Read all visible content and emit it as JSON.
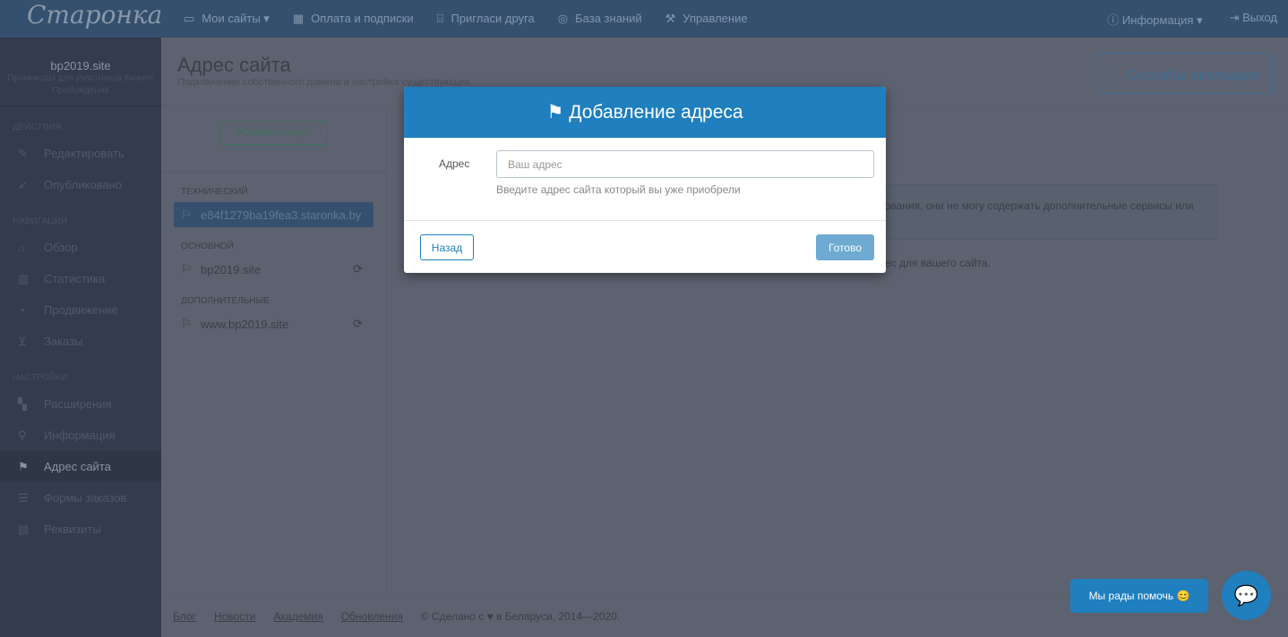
{
  "header": {
    "logo": "Старонка",
    "nav": [
      {
        "icon": "inbox-icon",
        "label": "Мои сайты ▾"
      },
      {
        "icon": "calendar-icon",
        "label": "Оплата и подписки"
      },
      {
        "icon": "gift-icon",
        "label": "Пригласи друга"
      },
      {
        "icon": "lifebuoy-icon",
        "label": "База знаний"
      },
      {
        "icon": "wrench-icon",
        "label": "Управление"
      }
    ],
    "info": "Информация ▾",
    "logout": "Выход"
  },
  "sidebar": {
    "site_name": "bp2019.site",
    "site_desc": "Промокоды для участников Бизнес Пробуждения",
    "sections": [
      {
        "title": "Действия",
        "items": [
          "Редактировать",
          "Опубликовано"
        ]
      },
      {
        "title": "Навигация",
        "items": [
          "Обзор",
          "Статистика",
          "Продвижение",
          "Заказы"
        ]
      },
      {
        "title": "Настройки",
        "items": [
          "Расширения",
          "Информация",
          "Адрес сайта",
          "Формы заказов",
          "Реквизиты"
        ]
      }
    ]
  },
  "page": {
    "title": "Адрес сайта",
    "subtitle": "Подключение собственного домена и настройка существующих",
    "activation": "Способы активации",
    "add_address": "Добавить адрес",
    "groups": [
      {
        "label": "Технический",
        "address": "e84f1279ba19fea3.staronka.by"
      },
      {
        "label": "Основной",
        "address": "bp2019.site"
      },
      {
        "label": "Дополнительные",
        "address": "www.bp2019.site"
      }
    ],
    "info_text": "рования, они не могу содержать дополнительные сервисы или",
    "info_text2": "ес для вашего сайта."
  },
  "footer": {
    "links": [
      "Блог",
      "Новости",
      "Академия",
      "Обновления"
    ],
    "copyright": "© Сделано с ♥ в Беларуси, 2014—2020."
  },
  "modal": {
    "title": "Добавление адреса",
    "field_label": "Адрес",
    "placeholder": "Ваш адрес",
    "value": "",
    "hint": "Введите адрес сайта который вы уже приобрели",
    "back": "Назад",
    "done": "Готово"
  },
  "chat": {
    "label": "Мы рады помочь 😊"
  }
}
